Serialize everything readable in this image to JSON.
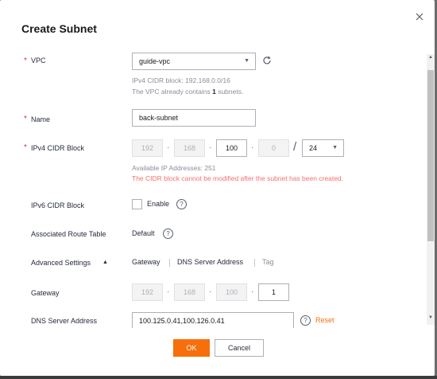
{
  "dialog": {
    "title": "Create Subnet",
    "required_mark": "*"
  },
  "vpc": {
    "label": "VPC",
    "selected": "guide-vpc",
    "cidr_hint": "IPv4 CIDR block: 192.168.0.0/16",
    "subnets_hint_prefix": "The VPC already contains ",
    "subnets_count": "1",
    "subnets_hint_suffix": " subnets."
  },
  "name": {
    "label": "Name",
    "value": "back-subnet"
  },
  "ipv4": {
    "label": "IPv4 CIDR Block",
    "octets": [
      "192",
      "168",
      "100",
      "0"
    ],
    "slash": "/",
    "mask": "24",
    "available": "Available IP Addresses: 251",
    "warning": "The CIDR block cannot be modified after the subnet has been created."
  },
  "ipv6": {
    "label": "IPv6 CIDR Block",
    "enable_label": "Enable"
  },
  "route_table": {
    "label": "Associated Route Table",
    "value": "Default"
  },
  "advanced": {
    "label": "Advanced Settings",
    "toggle": "▲",
    "links": [
      "Gateway",
      "DNS Server Address",
      "Tag"
    ]
  },
  "gateway": {
    "label": "Gateway",
    "octets": [
      "192",
      "168",
      "100",
      "1"
    ]
  },
  "dns": {
    "label": "DNS Server Address",
    "value": "100.125.0.41,100.126.0.41",
    "reset_label": "Reset"
  },
  "footer": {
    "ok_label": "OK",
    "cancel_label": "Cancel"
  },
  "colors": {
    "accent": "#f66f0c",
    "required": "#e0322b",
    "link": "#526ecc",
    "warning": "#f66f6a"
  },
  "icons": {
    "close": "close-icon",
    "refresh": "refresh-icon",
    "help": "question-circle-icon",
    "dropdown": "chevron-down-icon"
  }
}
